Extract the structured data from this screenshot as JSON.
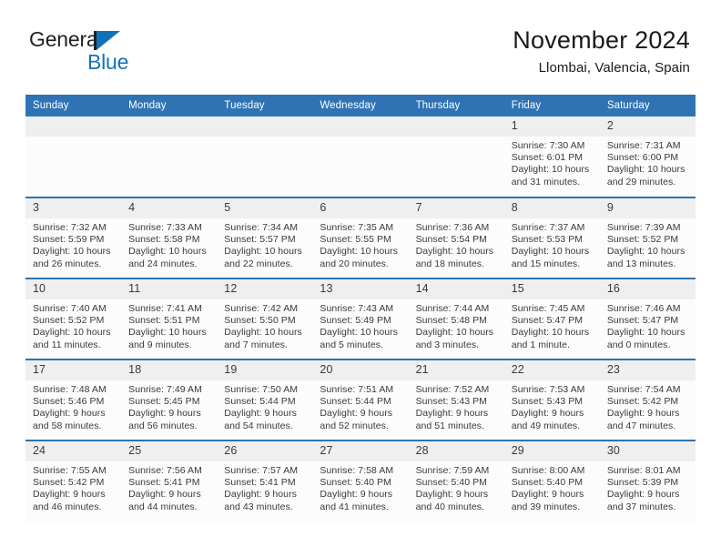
{
  "brand": {
    "name_part1": "General",
    "name_part2": "Blue",
    "triangle_color": "#1272b8"
  },
  "header": {
    "title": "November 2024",
    "subtitle": "Llombai, Valencia, Spain"
  },
  "colors": {
    "header_blue": "#2f73b4",
    "daynum_band": "#efefef",
    "cell_bg": "#fcfcfc",
    "text": "#3a3a3a"
  },
  "weekdays": [
    "Sunday",
    "Monday",
    "Tuesday",
    "Wednesday",
    "Thursday",
    "Friday",
    "Saturday"
  ],
  "weeks": [
    [
      {
        "day": "",
        "empty": true
      },
      {
        "day": "",
        "empty": true
      },
      {
        "day": "",
        "empty": true
      },
      {
        "day": "",
        "empty": true
      },
      {
        "day": "",
        "empty": true
      },
      {
        "day": "1",
        "sunrise": "Sunrise: 7:30 AM",
        "sunset": "Sunset: 6:01 PM",
        "daylight1": "Daylight: 10 hours",
        "daylight2": "and 31 minutes."
      },
      {
        "day": "2",
        "sunrise": "Sunrise: 7:31 AM",
        "sunset": "Sunset: 6:00 PM",
        "daylight1": "Daylight: 10 hours",
        "daylight2": "and 29 minutes."
      }
    ],
    [
      {
        "day": "3",
        "sunrise": "Sunrise: 7:32 AM",
        "sunset": "Sunset: 5:59 PM",
        "daylight1": "Daylight: 10 hours",
        "daylight2": "and 26 minutes."
      },
      {
        "day": "4",
        "sunrise": "Sunrise: 7:33 AM",
        "sunset": "Sunset: 5:58 PM",
        "daylight1": "Daylight: 10 hours",
        "daylight2": "and 24 minutes."
      },
      {
        "day": "5",
        "sunrise": "Sunrise: 7:34 AM",
        "sunset": "Sunset: 5:57 PM",
        "daylight1": "Daylight: 10 hours",
        "daylight2": "and 22 minutes."
      },
      {
        "day": "6",
        "sunrise": "Sunrise: 7:35 AM",
        "sunset": "Sunset: 5:55 PM",
        "daylight1": "Daylight: 10 hours",
        "daylight2": "and 20 minutes."
      },
      {
        "day": "7",
        "sunrise": "Sunrise: 7:36 AM",
        "sunset": "Sunset: 5:54 PM",
        "daylight1": "Daylight: 10 hours",
        "daylight2": "and 18 minutes."
      },
      {
        "day": "8",
        "sunrise": "Sunrise: 7:37 AM",
        "sunset": "Sunset: 5:53 PM",
        "daylight1": "Daylight: 10 hours",
        "daylight2": "and 15 minutes."
      },
      {
        "day": "9",
        "sunrise": "Sunrise: 7:39 AM",
        "sunset": "Sunset: 5:52 PM",
        "daylight1": "Daylight: 10 hours",
        "daylight2": "and 13 minutes."
      }
    ],
    [
      {
        "day": "10",
        "sunrise": "Sunrise: 7:40 AM",
        "sunset": "Sunset: 5:52 PM",
        "daylight1": "Daylight: 10 hours",
        "daylight2": "and 11 minutes."
      },
      {
        "day": "11",
        "sunrise": "Sunrise: 7:41 AM",
        "sunset": "Sunset: 5:51 PM",
        "daylight1": "Daylight: 10 hours",
        "daylight2": "and 9 minutes."
      },
      {
        "day": "12",
        "sunrise": "Sunrise: 7:42 AM",
        "sunset": "Sunset: 5:50 PM",
        "daylight1": "Daylight: 10 hours",
        "daylight2": "and 7 minutes."
      },
      {
        "day": "13",
        "sunrise": "Sunrise: 7:43 AM",
        "sunset": "Sunset: 5:49 PM",
        "daylight1": "Daylight: 10 hours",
        "daylight2": "and 5 minutes."
      },
      {
        "day": "14",
        "sunrise": "Sunrise: 7:44 AM",
        "sunset": "Sunset: 5:48 PM",
        "daylight1": "Daylight: 10 hours",
        "daylight2": "and 3 minutes."
      },
      {
        "day": "15",
        "sunrise": "Sunrise: 7:45 AM",
        "sunset": "Sunset: 5:47 PM",
        "daylight1": "Daylight: 10 hours",
        "daylight2": "and 1 minute."
      },
      {
        "day": "16",
        "sunrise": "Sunrise: 7:46 AM",
        "sunset": "Sunset: 5:47 PM",
        "daylight1": "Daylight: 10 hours",
        "daylight2": "and 0 minutes."
      }
    ],
    [
      {
        "day": "17",
        "sunrise": "Sunrise: 7:48 AM",
        "sunset": "Sunset: 5:46 PM",
        "daylight1": "Daylight: 9 hours",
        "daylight2": "and 58 minutes."
      },
      {
        "day": "18",
        "sunrise": "Sunrise: 7:49 AM",
        "sunset": "Sunset: 5:45 PM",
        "daylight1": "Daylight: 9 hours",
        "daylight2": "and 56 minutes."
      },
      {
        "day": "19",
        "sunrise": "Sunrise: 7:50 AM",
        "sunset": "Sunset: 5:44 PM",
        "daylight1": "Daylight: 9 hours",
        "daylight2": "and 54 minutes."
      },
      {
        "day": "20",
        "sunrise": "Sunrise: 7:51 AM",
        "sunset": "Sunset: 5:44 PM",
        "daylight1": "Daylight: 9 hours",
        "daylight2": "and 52 minutes."
      },
      {
        "day": "21",
        "sunrise": "Sunrise: 7:52 AM",
        "sunset": "Sunset: 5:43 PM",
        "daylight1": "Daylight: 9 hours",
        "daylight2": "and 51 minutes."
      },
      {
        "day": "22",
        "sunrise": "Sunrise: 7:53 AM",
        "sunset": "Sunset: 5:43 PM",
        "daylight1": "Daylight: 9 hours",
        "daylight2": "and 49 minutes."
      },
      {
        "day": "23",
        "sunrise": "Sunrise: 7:54 AM",
        "sunset": "Sunset: 5:42 PM",
        "daylight1": "Daylight: 9 hours",
        "daylight2": "and 47 minutes."
      }
    ],
    [
      {
        "day": "24",
        "sunrise": "Sunrise: 7:55 AM",
        "sunset": "Sunset: 5:42 PM",
        "daylight1": "Daylight: 9 hours",
        "daylight2": "and 46 minutes."
      },
      {
        "day": "25",
        "sunrise": "Sunrise: 7:56 AM",
        "sunset": "Sunset: 5:41 PM",
        "daylight1": "Daylight: 9 hours",
        "daylight2": "and 44 minutes."
      },
      {
        "day": "26",
        "sunrise": "Sunrise: 7:57 AM",
        "sunset": "Sunset: 5:41 PM",
        "daylight1": "Daylight: 9 hours",
        "daylight2": "and 43 minutes."
      },
      {
        "day": "27",
        "sunrise": "Sunrise: 7:58 AM",
        "sunset": "Sunset: 5:40 PM",
        "daylight1": "Daylight: 9 hours",
        "daylight2": "and 41 minutes."
      },
      {
        "day": "28",
        "sunrise": "Sunrise: 7:59 AM",
        "sunset": "Sunset: 5:40 PM",
        "daylight1": "Daylight: 9 hours",
        "daylight2": "and 40 minutes."
      },
      {
        "day": "29",
        "sunrise": "Sunrise: 8:00 AM",
        "sunset": "Sunset: 5:40 PM",
        "daylight1": "Daylight: 9 hours",
        "daylight2": "and 39 minutes."
      },
      {
        "day": "30",
        "sunrise": "Sunrise: 8:01 AM",
        "sunset": "Sunset: 5:39 PM",
        "daylight1": "Daylight: 9 hours",
        "daylight2": "and 37 minutes."
      }
    ]
  ]
}
